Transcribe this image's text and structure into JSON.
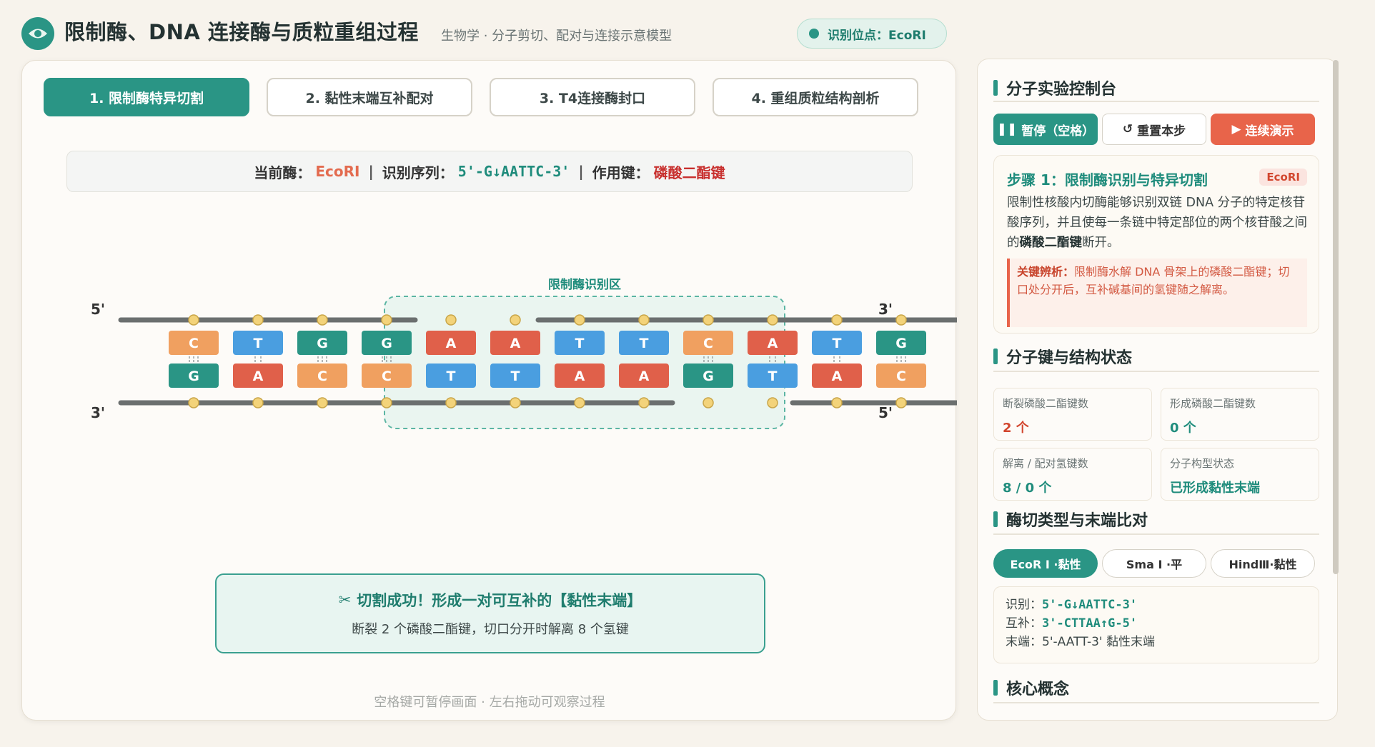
{
  "header": {
    "title": "限制酶、DNA 连接酶与质粒重组过程",
    "subtitle": "生物学 · 分子剪切、配对与连接示意模型",
    "site_badge": "识别位点：EcoRI"
  },
  "tabs": [
    {
      "label": "1. 限制酶特异切割",
      "active": true
    },
    {
      "label": "2. 黏性末端互补配对",
      "active": false
    },
    {
      "label": "3. T4连接酶封口",
      "active": false
    },
    {
      "label": "4. 重组质粒结构剖析",
      "active": false
    }
  ],
  "info_bar": {
    "enzyme_label": "当前酶：",
    "enzyme": "EcoRI",
    "seq_label": "识别序列：",
    "seq": "5'-G↓AATTC-3'",
    "bond_label": "作用键：",
    "bond": "磷酸二酯键"
  },
  "diagram": {
    "region_label": "限制酶识别区",
    "labels": {
      "top_left": "5'",
      "top_right": "3'",
      "bottom_left": "3'",
      "bottom_right": "5'"
    },
    "top_left": [
      "C",
      "T",
      "G",
      "G"
    ],
    "top_right": [
      "A",
      "A",
      "T",
      "T",
      "C",
      "A",
      "T",
      "G"
    ],
    "bottom_left": [
      "G",
      "A",
      "C",
      "C",
      "T",
      "T",
      "A",
      "A"
    ],
    "bottom_right": [
      "G",
      "T",
      "A",
      "C"
    ],
    "colors": {
      "A": "#e0604a",
      "T": "#4a9ee0",
      "G": "#2a9585",
      "C": "#f0a060",
      "backbone": "#6b6f6f",
      "phosphate": "#f3d37a"
    }
  },
  "success": {
    "title": "切割成功！形成一对可互补的【黏性末端】",
    "desc": "断裂 2 个磷酸二酯键，切口分开时解离 8 个氢键"
  },
  "hint": "空格键可暂停画面 · 左右拖动可观察过程",
  "side": {
    "console_title": "分子实验控制台",
    "buttons": {
      "pause": "暂停（空格）",
      "reset": "重置本步",
      "play": "连续演示"
    },
    "step": {
      "title": "步骤 1：限制酶识别与特异切割",
      "badge": "EcoRI",
      "text_a": "限制性核酸内切酶能够识别双链 DNA 分子的特定核苷酸序列，并且使每一条链中特定部位的两个核苷酸之间的",
      "text_bold": "磷酸二酯键",
      "text_b": "断开。",
      "key_label": "关键辨析：",
      "key_text": "限制酶水解 DNA 骨架上的磷酸二酯键；切口处分开后，互补碱基间的氢键随之解离。"
    },
    "status_title": "分子键与结构状态",
    "stats": [
      {
        "label": "断裂磷酸二酯键数",
        "value": "2 个",
        "color": "red"
      },
      {
        "label": "形成磷酸二酯键数",
        "value": "0 个",
        "color": "teal"
      },
      {
        "label": "解离 / 配对氢键数",
        "value": "8 / 0 个",
        "color": "teal"
      },
      {
        "label": "分子构型状态",
        "value": "已形成黏性末端",
        "color": "teal"
      }
    ],
    "type_title": "酶切类型与末端比对",
    "types": [
      {
        "label": "EcoR Ⅰ ·黏性",
        "active": true
      },
      {
        "label": "Sma Ⅰ ·平",
        "active": false
      },
      {
        "label": "HindⅢ·黏性",
        "active": false
      }
    ],
    "ends": {
      "recog_label": "识别：",
      "recog": "5'-G↓AATTC-3'",
      "comp_label": "互补：",
      "comp": "3'-CTTAA↑G-5'",
      "end_label": "末端：",
      "end": "5'-AATT-3' 黏性末端"
    },
    "concept_title": "核心概念"
  }
}
